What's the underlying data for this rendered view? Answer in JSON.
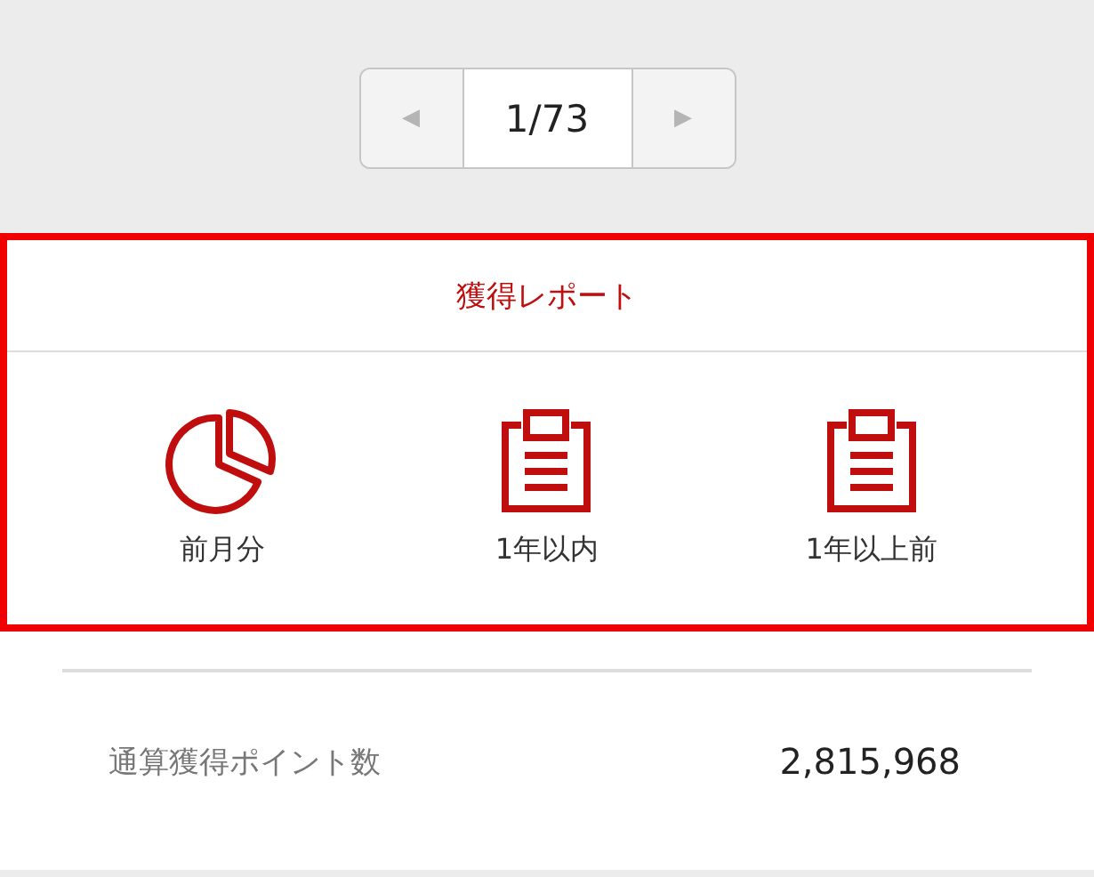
{
  "pager": {
    "prev": "◀",
    "page": "1/73",
    "next": "▶"
  },
  "report": {
    "title": "獲得レポート",
    "highlighted": true,
    "items": [
      {
        "kind": "pie",
        "label": "前月分"
      },
      {
        "kind": "clipboard",
        "label": "1年以内"
      },
      {
        "kind": "clipboard",
        "label": "1年以上前"
      }
    ]
  },
  "summary": {
    "label": "通算獲得ポイント数",
    "value": "2,815,968"
  }
}
